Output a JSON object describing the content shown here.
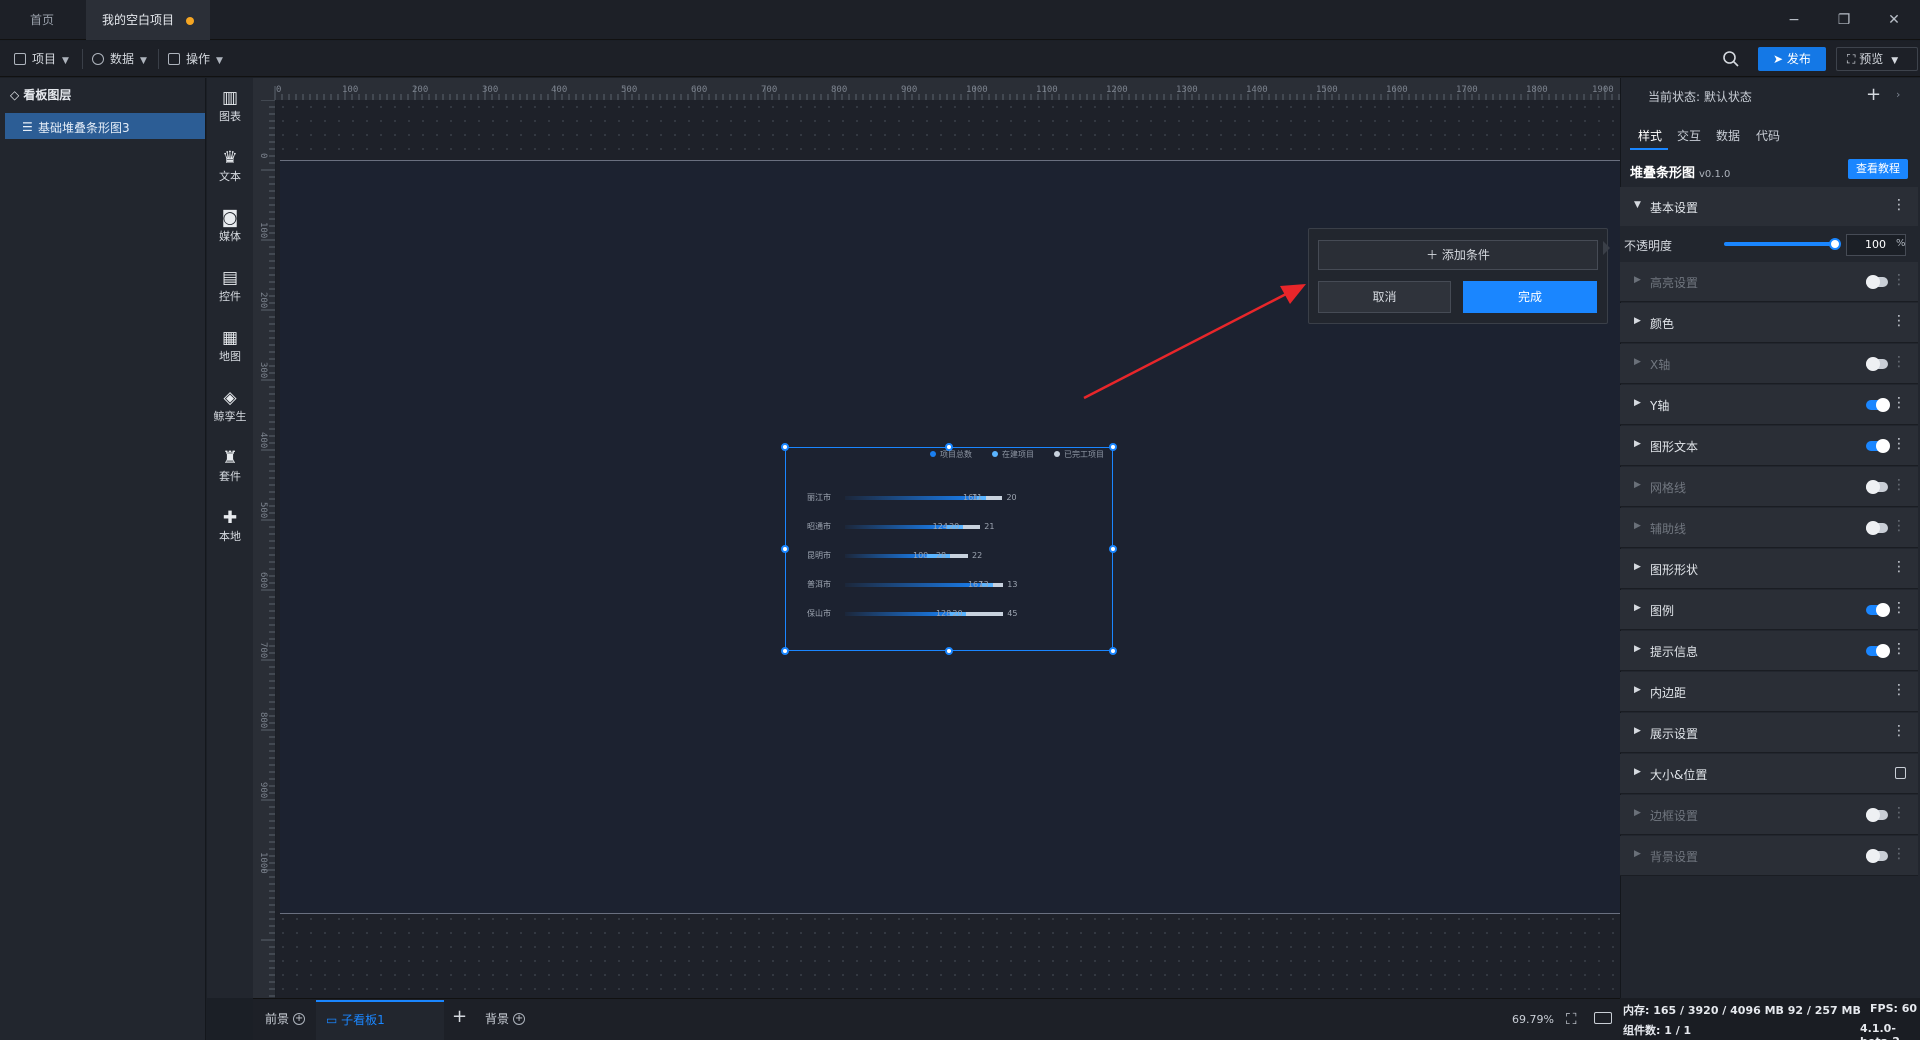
{
  "titlebar": {
    "tab_home": "首页",
    "tab_project": "我的空白项目",
    "minimize": "−",
    "restore": "❐",
    "close": "✕"
  },
  "menubar": {
    "project": "项目",
    "data": "数据",
    "operations": "操作",
    "publish": "发布",
    "preview": "预览"
  },
  "layers": {
    "title": "看板图层",
    "items": [
      {
        "label": "基础堆叠条形图3"
      }
    ]
  },
  "components": [
    {
      "label": "图表",
      "icon": "chart-icon",
      "glyph": "▥"
    },
    {
      "label": "文本",
      "icon": "text-icon",
      "glyph": "♛"
    },
    {
      "label": "媒体",
      "icon": "media-icon",
      "glyph": "◙"
    },
    {
      "label": "控件",
      "icon": "widget-icon",
      "glyph": "▤"
    },
    {
      "label": "地图",
      "icon": "map-icon",
      "glyph": "▦"
    },
    {
      "label": "鲸孪生",
      "icon": "twin-icon",
      "glyph": "◈"
    },
    {
      "label": "套件",
      "icon": "kit-icon",
      "glyph": "♜"
    },
    {
      "label": "本地",
      "icon": "local-icon",
      "glyph": "✚"
    }
  ],
  "ruler": {
    "top": [
      "0",
      "100",
      "200",
      "300",
      "400",
      "500",
      "600",
      "700",
      "800",
      "900",
      "1000",
      "1100",
      "1200",
      "1300",
      "1400",
      "1500",
      "1600",
      "1700",
      "1800",
      "1900"
    ],
    "left": [
      "0",
      "100",
      "200",
      "300",
      "400",
      "500",
      "600",
      "700",
      "800",
      "900",
      "1000"
    ]
  },
  "chart_data": {
    "type": "bar",
    "orientation": "horizontal",
    "stacked": true,
    "categories": [
      "丽江市",
      "昭通市",
      "昆明市",
      "普洱市",
      "保山市"
    ],
    "series": [
      {
        "name": "项目总数",
        "values": [
          161,
          124,
          100,
          167,
          128
        ]
      },
      {
        "name": "在建项目",
        "values": [
          11,
          20,
          28,
          13,
          20
        ]
      },
      {
        "name": "已完工项目",
        "values": [
          20,
          21,
          22,
          13,
          45
        ]
      }
    ],
    "legend_position": "top-right",
    "colors": [
      "#1a7ff0",
      "#5ab4ff",
      "#c8d2de"
    ]
  },
  "popup": {
    "add_condition": "添加条件",
    "cancel": "取消",
    "done": "完成"
  },
  "bottombar": {
    "foreground": "前景",
    "subboard": "子看板1",
    "background": "背景",
    "zoom": "69.79%"
  },
  "rpanel": {
    "state_label": "当前状态: 默认状态",
    "tabs": [
      "样式",
      "交互",
      "数据",
      "代码"
    ],
    "component_name": "堆叠条形图",
    "component_version": "v0.1.0",
    "tutorial": "查看教程",
    "opacity_label": "不透明度",
    "opacity_value": "100",
    "opacity_unit": "%",
    "sections": [
      {
        "label": "基本设置"
      },
      {
        "label": "高亮设置"
      },
      {
        "label": "颜色"
      },
      {
        "label": "X轴"
      },
      {
        "label": "Y轴"
      },
      {
        "label": "图形文本"
      },
      {
        "label": "网格线"
      },
      {
        "label": "辅助线"
      },
      {
        "label": "图形形状"
      },
      {
        "label": "图例"
      },
      {
        "label": "提示信息"
      },
      {
        "label": "内边距"
      },
      {
        "label": "展示设置"
      },
      {
        "label": "大小&位置"
      },
      {
        "label": "边框设置"
      },
      {
        "label": "背景设置"
      }
    ]
  },
  "status": {
    "memory": "内存: 165 / 3920 / 4096 MB  92 / 257 MB",
    "fps": "FPS: 60",
    "components": "组件数: 1 / 1",
    "version": "4.1.0-beta.2"
  }
}
